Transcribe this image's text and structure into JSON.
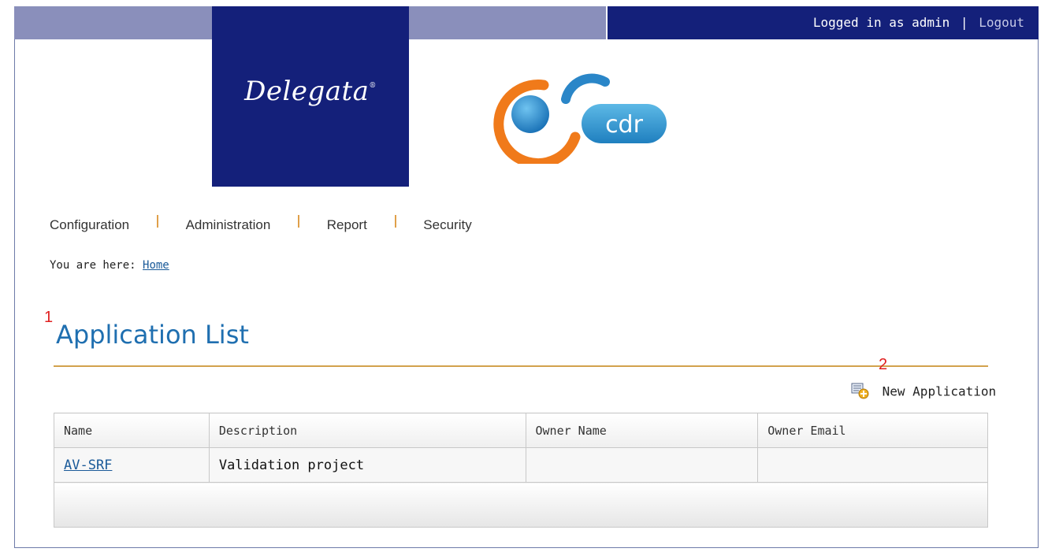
{
  "header": {
    "brand": "Delegata",
    "brand_mark": "®",
    "logged_in_text": "Logged in as admin",
    "separator": "|",
    "logout_label": "Logout",
    "product_logo_text": "cdr",
    "colors": {
      "navy": "#14207a",
      "lavender": "#8a8fbb",
      "orange": "#f07a1a",
      "blue": "#2a86c8"
    }
  },
  "menu": {
    "items": [
      {
        "label": "Configuration"
      },
      {
        "label": "Administration"
      },
      {
        "label": "Report"
      },
      {
        "label": "Security"
      }
    ]
  },
  "breadcrumb": {
    "prefix": "You are here:",
    "home_label": "Home"
  },
  "markers": {
    "one": "1",
    "two": "2"
  },
  "main": {
    "title": "Application List",
    "new_application_label": "New Application",
    "new_application_icon": "add-document-icon"
  },
  "table": {
    "columns": [
      "Name",
      "Description",
      "Owner Name",
      "Owner Email"
    ],
    "rows": [
      {
        "name": "AV-SRF",
        "description": "Validation project",
        "owner_name": "",
        "owner_email": ""
      }
    ]
  }
}
